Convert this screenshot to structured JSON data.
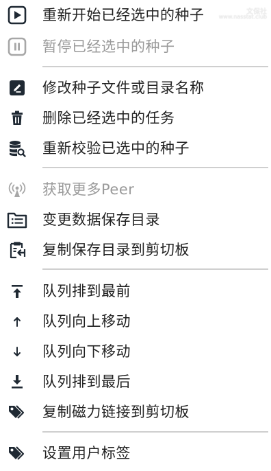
{
  "menu": {
    "items": [
      {
        "label": "重新开始已经选中的种子",
        "icon": "play-icon",
        "disabled": false
      },
      {
        "label": "暂停已经选中的种子",
        "icon": "pause-icon",
        "disabled": true
      },
      {
        "label": "修改种子文件或目录名称",
        "icon": "edit-icon",
        "disabled": false
      },
      {
        "label": "删除已经选中的任务",
        "icon": "trash-icon",
        "disabled": false
      },
      {
        "label": "重新校验已选中的种子",
        "icon": "database-search-icon",
        "disabled": false
      },
      {
        "label": "获取更多Peer",
        "icon": "antenna-icon",
        "disabled": true
      },
      {
        "label": "变更数据保存目录",
        "icon": "folder-list-icon",
        "disabled": false
      },
      {
        "label": "复制保存目录到剪切板",
        "icon": "clipboard-copy-icon",
        "disabled": false
      },
      {
        "label": "队列排到最前",
        "icon": "arrow-top-icon",
        "disabled": false
      },
      {
        "label": "队列向上移动",
        "icon": "arrow-up-icon",
        "disabled": false
      },
      {
        "label": "队列向下移动",
        "icon": "arrow-down-icon",
        "disabled": false
      },
      {
        "label": "队列排到最后",
        "icon": "arrow-bottom-icon",
        "disabled": false
      },
      {
        "label": "复制磁力链接到剪切板",
        "icon": "tags-icon",
        "disabled": false
      },
      {
        "label": "设置用户标签",
        "icon": "tags-icon",
        "disabled": false
      }
    ]
  },
  "watermark": {
    "line1": "文保社",
    "line2": "www.nasstat.club"
  },
  "colors": {
    "text": "#222222",
    "disabled_text": "#9a9a9a",
    "icon": "#1f2933",
    "disabled_icon": "#a7a7a7",
    "separator": "#cfcfcf"
  }
}
